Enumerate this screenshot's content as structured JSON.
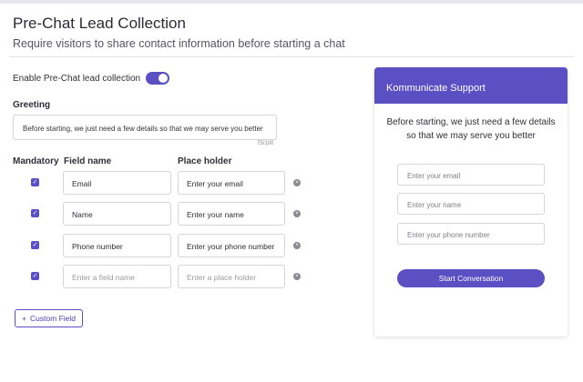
{
  "header": {
    "title": "Pre-Chat Lead Collection",
    "subtitle": "Require visitors to share contact information before starting a chat"
  },
  "toggle": {
    "label": "Enable Pre-Chat lead collection",
    "enabled": true
  },
  "greeting": {
    "label": "Greeting",
    "value": "Before starting, we just need a few details so that we may serve you better",
    "count": "75/100"
  },
  "columns": {
    "mandatory": "Mandatory",
    "field_name": "Field name",
    "placeholder": "Place holder"
  },
  "fields": [
    {
      "name": "Email",
      "placeholder": "Enter your email",
      "mandatory": true
    },
    {
      "name": "Name",
      "placeholder": "Enter your name",
      "mandatory": true
    },
    {
      "name": "Phone number",
      "placeholder": "Enter your phone number",
      "mandatory": true
    },
    {
      "name": "",
      "placeholder": "",
      "name_hint": "Enter a field name",
      "placeholder_hint": "Enter a place holder",
      "mandatory": true
    }
  ],
  "custom_field_button": "Custom Field",
  "preview": {
    "header": "Kommunicate Support",
    "message": "Before starting, we just need a few details so that we may serve you better",
    "inputs": [
      "Enter your email",
      "Enter your name",
      "Enter your phone number"
    ],
    "button": "Start Conversation"
  },
  "colors": {
    "accent": "#5b4fc4"
  }
}
